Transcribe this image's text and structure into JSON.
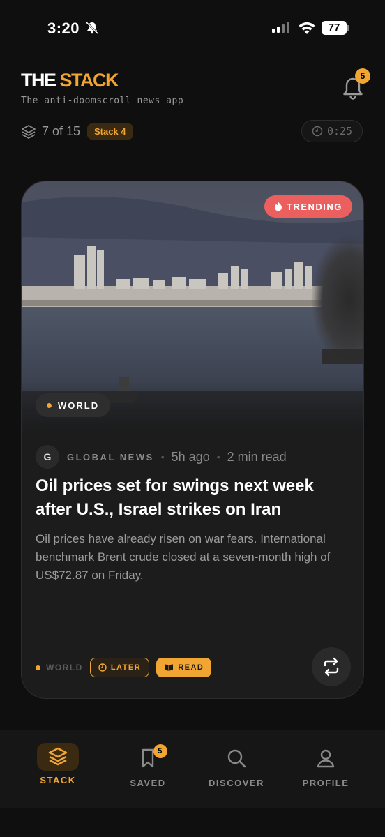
{
  "status_bar": {
    "time": "3:20",
    "battery": "77"
  },
  "header": {
    "brand_part1": "THE",
    "brand_part2": "STACK",
    "tagline": "The anti-doomscroll news app",
    "notification_count": "5"
  },
  "progress": {
    "position": "7 of 15",
    "stack_label": "Stack 4",
    "timer": "0:25"
  },
  "card": {
    "trending_label": "TRENDING",
    "category": "WORLD",
    "source_initial": "G",
    "source_name": "GLOBAL NEWS",
    "age": "5h ago",
    "read_time": "2 min read",
    "headline": "Oil prices set for swings next week after U.S., Israel strikes on Iran",
    "summary": "Oil prices have already risen on war fears. International benchmark Brent crude closed at a seven-month high of US$72.87 on Friday.",
    "footer_category": "WORLD",
    "later_label": "LATER",
    "read_label": "READ"
  },
  "nav": {
    "items": [
      {
        "label": "STACK",
        "icon": "stack-icon",
        "active": true
      },
      {
        "label": "SAVED",
        "icon": "bookmark-icon",
        "badge": "5"
      },
      {
        "label": "DISCOVER",
        "icon": "search-icon"
      },
      {
        "label": "PROFILE",
        "icon": "user-icon"
      }
    ]
  },
  "colors": {
    "accent": "#f1a634",
    "trending": "#ec5f5f",
    "background": "#0f0f0f",
    "card": "#1c1c1c"
  }
}
